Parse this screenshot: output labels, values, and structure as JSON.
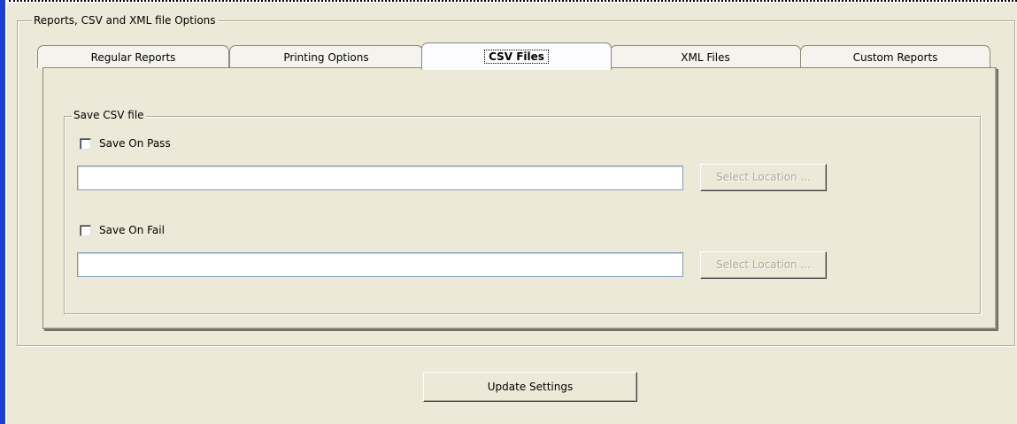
{
  "group": {
    "title": "Reports, CSV and XML file Options"
  },
  "tabs": [
    {
      "label": "Regular Reports",
      "active": false
    },
    {
      "label": "Printing Options",
      "active": false
    },
    {
      "label": "CSV Files",
      "active": true
    },
    {
      "label": "XML Files",
      "active": false
    },
    {
      "label": "Custom Reports",
      "active": false
    }
  ],
  "csv": {
    "group_title": "Save CSV file",
    "pass": {
      "checkbox_label": "Save On Pass",
      "checked": false,
      "path_value": "",
      "button_label": "Select Location ...",
      "button_enabled": false
    },
    "fail": {
      "checkbox_label": "Save On Fail",
      "checked": false,
      "path_value": "",
      "button_label": "Select Location ...",
      "button_enabled": false
    }
  },
  "update_button": {
    "label": "Update Settings"
  }
}
